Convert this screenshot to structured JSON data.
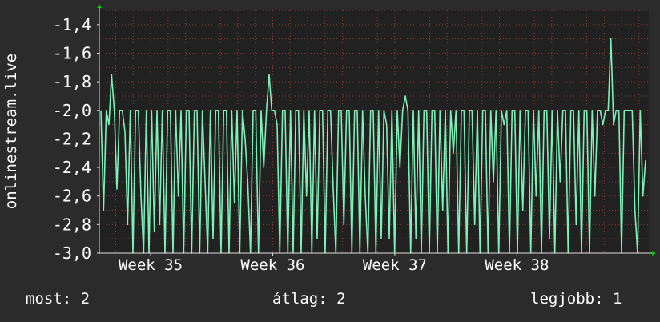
{
  "colors": {
    "background": "#2b2b2b",
    "plot_background": "#212121",
    "grid": "#8a3a3a",
    "series": "#7ef0b8",
    "axis": "#dddddd",
    "arrow": "#00cc00",
    "text": "#ffffff"
  },
  "stats": {
    "current": "most: 2",
    "average": "átlag: 2",
    "best": "legjobb: 1"
  },
  "chart_data": {
    "type": "line",
    "title": "",
    "ylabel": "onlinestream.live",
    "xlabel": "",
    "x_ticks": [
      "Week 35",
      "Week 36",
      "Week 37",
      "Week 38"
    ],
    "x_tick_positions": [
      35,
      36,
      37,
      38
    ],
    "xlim": [
      34.58,
      39.08
    ],
    "y_ticks": [
      "-1,4",
      "-1,6",
      "-1,8",
      "-2,0",
      "-2,2",
      "-2,4",
      "-2,6",
      "-2,8",
      "-3,0"
    ],
    "y_tick_values": [
      -1.4,
      -1.6,
      -1.8,
      -2.0,
      -2.2,
      -2.4,
      -2.6,
      -2.8,
      -3.0
    ],
    "ylim": [
      -3.0,
      -1.3
    ],
    "grid": true,
    "series": [
      {
        "name": "",
        "values": [
          -2.0,
          -2.7,
          -2.0,
          -2.1,
          -1.75,
          -2.0,
          -2.55,
          -2.0,
          -2.0,
          -2.15,
          -2.8,
          -2.0,
          -3.0,
          -2.0,
          -2.0,
          -2.6,
          -3.0,
          -2.0,
          -3.0,
          -2.0,
          -2.85,
          -2.0,
          -2.8,
          -2.0,
          -3.0,
          -2.0,
          -2.0,
          -3.0,
          -2.0,
          -2.6,
          -2.0,
          -3.0,
          -2.0,
          -2.0,
          -3.0,
          -2.0,
          -2.0,
          -3.0,
          -2.0,
          -2.5,
          -3.0,
          -2.0,
          -2.9,
          -2.0,
          -2.0,
          -3.0,
          -2.0,
          -2.0,
          -3.0,
          -2.0,
          -2.65,
          -2.0,
          -3.0,
          -2.0,
          -2.2,
          -2.5,
          -3.0,
          -2.0,
          -2.0,
          -3.0,
          -2.0,
          -2.4,
          -2.0,
          -1.75,
          -2.0,
          -2.0,
          -2.1,
          -3.0,
          -2.0,
          -2.0,
          -3.0,
          -2.0,
          -3.0,
          -2.0,
          -2.0,
          -3.0,
          -2.0,
          -2.6,
          -2.0,
          -3.0,
          -2.0,
          -2.9,
          -2.0,
          -2.0,
          -3.0,
          -2.0,
          -2.0,
          -2.55,
          -3.0,
          -2.0,
          -2.0,
          -2.8,
          -2.0,
          -2.0,
          -3.0,
          -2.0,
          -2.0,
          -3.0,
          -2.0,
          -2.6,
          -3.0,
          -2.0,
          -2.0,
          -3.0,
          -2.0,
          -2.9,
          -2.0,
          -2.1,
          -2.9,
          -2.0,
          -3.0,
          -2.0,
          -2.4,
          -2.0,
          -1.9,
          -2.0,
          -3.0,
          -2.0,
          -2.9,
          -2.0,
          -3.0,
          -2.0,
          -2.0,
          -3.0,
          -2.0,
          -2.0,
          -3.0,
          -2.0,
          -2.7,
          -2.0,
          -3.0,
          -2.0,
          -2.3,
          -2.0,
          -3.0,
          -2.0,
          -2.0,
          -3.0,
          -2.0,
          -2.0,
          -2.8,
          -2.0,
          -3.0,
          -2.0,
          -2.0,
          -3.0,
          -2.0,
          -2.5,
          -2.0,
          -3.0,
          -2.0,
          -2.1,
          -2.0,
          -3.0,
          -2.0,
          -2.0,
          -3.0,
          -2.0,
          -2.7,
          -2.0,
          -2.0,
          -3.0,
          -2.0,
          -2.6,
          -2.0,
          -3.0,
          -2.0,
          -2.0,
          -2.9,
          -2.0,
          -3.0,
          -2.0,
          -2.5,
          -2.0,
          -2.0,
          -3.0,
          -2.0,
          -2.0,
          -2.8,
          -2.0,
          -3.0,
          -2.0,
          -2.0,
          -3.0,
          -2.0,
          -2.6,
          -2.0,
          -2.0,
          -2.1,
          -2.0,
          -2.0,
          -1.5,
          -2.1,
          -2.0,
          -2.0,
          -3.0,
          -2.0,
          -2.0,
          -2.0,
          -2.0,
          -2.7,
          -3.0,
          -2.0,
          -2.6,
          -2.35
        ]
      }
    ]
  }
}
